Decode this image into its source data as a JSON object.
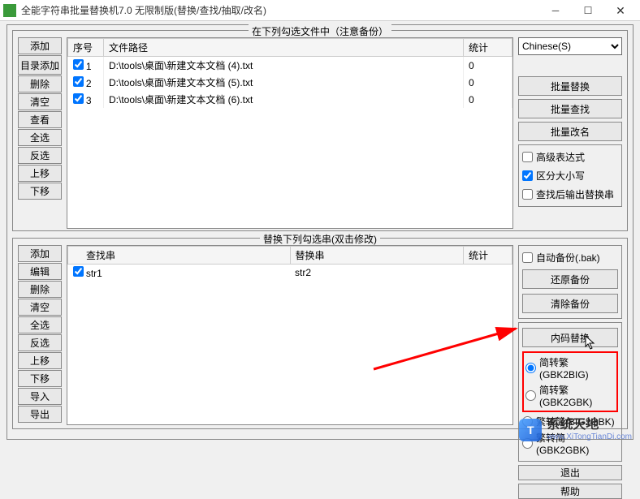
{
  "titlebar": {
    "title": "全能字符串批量替换机7.0 无限制版(替换/查找/抽取/改名)"
  },
  "top": {
    "section_label": "在下列勾选文件中（注意备份）",
    "side_buttons": [
      "添加",
      "目录添加",
      "删除",
      "清空",
      "查看",
      "全选",
      "反选",
      "上移",
      "下移"
    ],
    "columns": {
      "seq": "序号",
      "path": "文件路径",
      "stat": "统计"
    },
    "rows": [
      {
        "checked": true,
        "seq": "1",
        "path": "D:\\tools\\桌面\\新建文本文档 (4).txt",
        "stat": "0"
      },
      {
        "checked": true,
        "seq": "2",
        "path": "D:\\tools\\桌面\\新建文本文档 (5).txt",
        "stat": "0"
      },
      {
        "checked": true,
        "seq": "3",
        "path": "D:\\tools\\桌面\\新建文本文档 (6).txt",
        "stat": "0"
      }
    ]
  },
  "right": {
    "encoding_selected": "Chinese(S)",
    "batch_buttons": [
      "批量替换",
      "批量查找",
      "批量改名"
    ],
    "opts": {
      "adv_expr": {
        "label": "高级表达式",
        "checked": false
      },
      "case_sens": {
        "label": "区分大小写",
        "checked": true
      },
      "output_after": {
        "label": "查找后输出替换串",
        "checked": false
      },
      "auto_bak": {
        "label": "自动备份(.bak)",
        "checked": false
      }
    },
    "backup_buttons": [
      "还原备份",
      "清除备份"
    ],
    "encode_btn": "内码替换",
    "encode_opts": [
      {
        "label": "简转繁(GBK2BIG)",
        "checked": true
      },
      {
        "label": "简转繁(GBK2GBK)",
        "checked": false
      },
      {
        "label": "繁转简(BIG2GBK)",
        "checked": false
      },
      {
        "label": "繁转简(GBK2GBK)",
        "checked": false
      }
    ],
    "bottom_buttons": [
      "退出",
      "帮助"
    ]
  },
  "bottom": {
    "section_label": "替换下列勾选串(双击修改)",
    "side_buttons": [
      "添加",
      "编辑",
      "删除",
      "清空",
      "全选",
      "反选",
      "上移",
      "下移",
      "导入",
      "导出"
    ],
    "columns": {
      "search": "查找串",
      "replace": "替换串",
      "stat": "统计"
    },
    "rows": [
      {
        "checked": true,
        "search": "str1",
        "replace": "str2",
        "stat": ""
      }
    ]
  },
  "watermark": {
    "cn": "系统天地",
    "en": "www.XiTongTianDi.com"
  }
}
